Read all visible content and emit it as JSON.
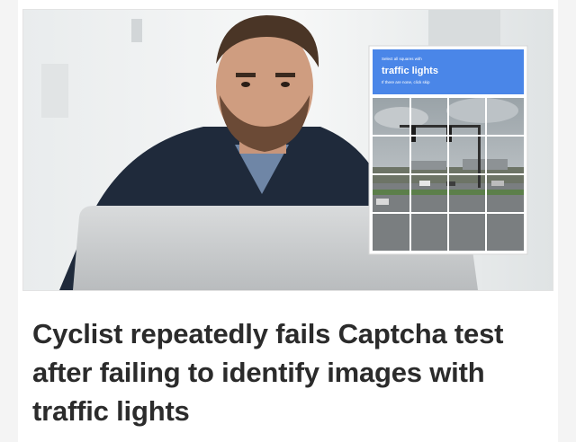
{
  "article": {
    "headline": "Cyclist repeatedly fails Captcha test after failing to identify images with traffic lights"
  },
  "captcha": {
    "prompt_small": "Select all squares with",
    "prompt_main": "traffic lights",
    "prompt_sub": "If there are none, click skip"
  },
  "colors": {
    "captcha_header": "#4a86e8",
    "headline_text": "#2b2b2b"
  }
}
